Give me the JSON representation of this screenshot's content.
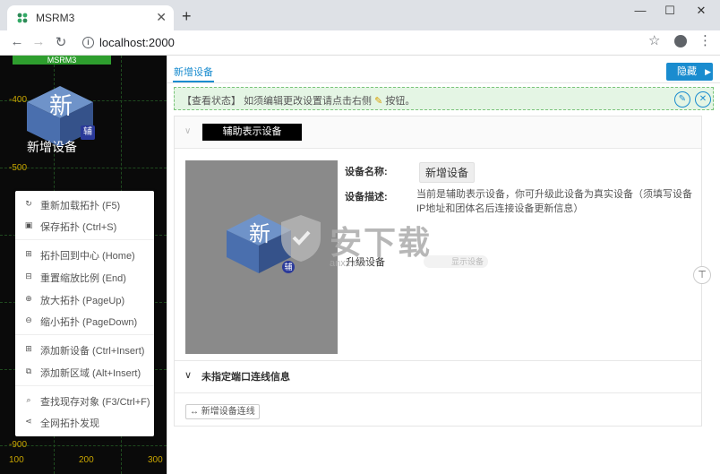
{
  "browser": {
    "tab_title": "MSRM3",
    "url": "localhost:2000"
  },
  "canvas": {
    "banner": "MSRM3",
    "y_labels": [
      "-400",
      "-500",
      "-900"
    ],
    "x_labels": [
      "100",
      "200",
      "300"
    ],
    "node_char": "新",
    "node_caption": "新增设备",
    "node_badge": "辅"
  },
  "context_menu": {
    "items": [
      {
        "label": "重新加载拓扑 (F5)",
        "icon": "refresh-icon"
      },
      {
        "label": "保存拓扑 (Ctrl+S)",
        "icon": "save-icon"
      },
      {
        "label": "拓扑回到中心 (Home)",
        "icon": "center-icon"
      },
      {
        "label": "重置缩放比例 (End)",
        "icon": "reset-zoom-icon"
      },
      {
        "label": "放大拓扑 (PageUp)",
        "icon": "zoom-in-icon"
      },
      {
        "label": "缩小拓扑 (PageDown)",
        "icon": "zoom-out-icon"
      },
      {
        "label": "添加新设备 (Ctrl+Insert)",
        "icon": "add-device-icon"
      },
      {
        "label": "添加新区域 (Alt+Insert)",
        "icon": "add-area-icon"
      },
      {
        "label": "查找现存对象 (F3/Ctrl+F)",
        "icon": "search-icon"
      },
      {
        "label": "全网拓扑发现",
        "icon": "share-icon"
      }
    ]
  },
  "panel": {
    "tab": "新增设备",
    "hide_button": "隐藏",
    "alert": {
      "prefix": "【查看状态】",
      "text": "如须编辑更改设置请点击右侧",
      "suffix": "按钮。"
    },
    "section_title": "辅助表示设备",
    "preview": {
      "char": "新",
      "badge": "辅"
    },
    "name_label": "设备名称:",
    "name_value": "新增设备",
    "desc_label": "设备描述:",
    "desc_value": "当前是辅助表示设备，你可升级此设备为真实设备（须填写设备IP地址和团体名后连接设备更新信息）",
    "upgrade_label": "升级设备",
    "upgrade_toggle": "显示设备",
    "port_section": "未指定端口连线信息",
    "add_link": "新增设备连线"
  },
  "watermark": {
    "text": "安下载",
    "url": "anxz.com"
  },
  "colors": {
    "accent": "#1a8ccf",
    "canvas_bg": "#0a0a0a",
    "banner": "#2e9e2e",
    "alert_bg": "#e4f5e4"
  }
}
